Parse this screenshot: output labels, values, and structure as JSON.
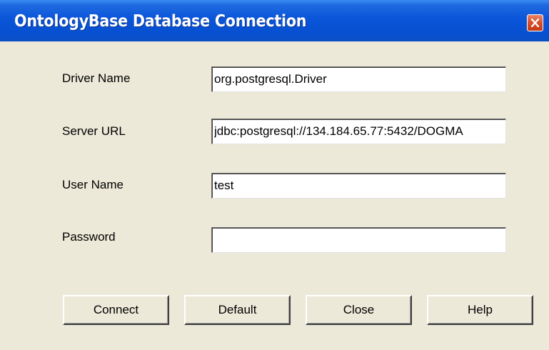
{
  "window": {
    "title": "OntologyBase Database Connection"
  },
  "form": {
    "driver_name": {
      "label": "Driver Name",
      "value": "org.postgresql.Driver"
    },
    "server_url": {
      "label": "Server URL",
      "value": "jdbc:postgresql://134.184.65.77:5432/DOGMA"
    },
    "user_name": {
      "label": "User Name",
      "value": "test"
    },
    "password": {
      "label": "Password",
      "value": ""
    }
  },
  "buttons": {
    "connect": "Connect",
    "default": "Default",
    "close": "Close",
    "help": "Help"
  },
  "icons": {
    "close": "close-icon"
  },
  "colors": {
    "titlebar": "#0a55d9",
    "dialog_background": "#ece9d8",
    "close_button": "#d6502c"
  }
}
